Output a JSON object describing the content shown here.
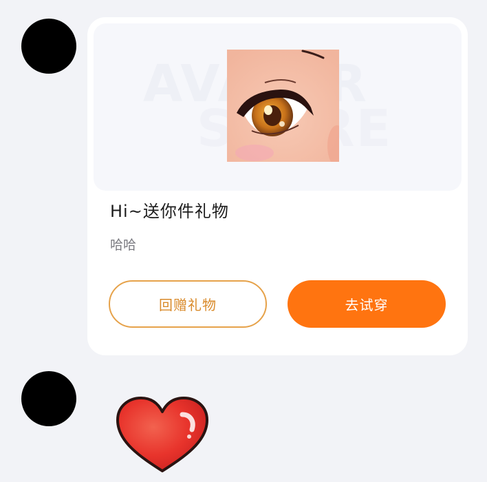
{
  "chat": {
    "messages": [
      {
        "type": "gift_card",
        "card": {
          "banner_watermark": [
            "AVATAR",
            "STORE"
          ],
          "title": "Hi~送你件礼物",
          "subtitle": "哈哈",
          "buttons": {
            "return_gift": "回赠礼物",
            "try_on": "去试穿"
          }
        }
      },
      {
        "type": "sticker",
        "sticker_icon": "heart-icon"
      }
    ]
  },
  "colors": {
    "background": "#f2f3f7",
    "card_bg": "#ffffff",
    "accent_orange": "#ff7410",
    "outline_orange": "#e6a24a",
    "heart_red": "#e8342c"
  }
}
